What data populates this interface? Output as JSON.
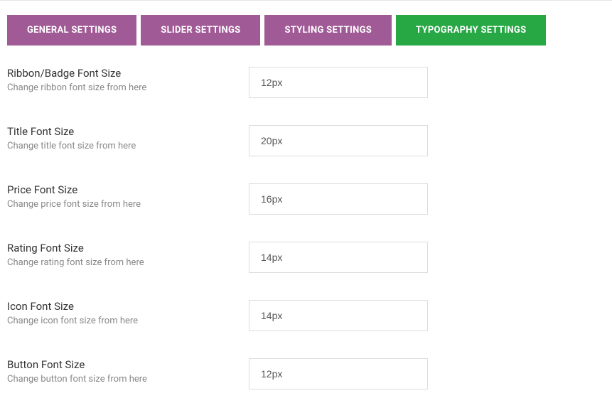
{
  "tabs": [
    {
      "label": "GENERAL SETTINGS",
      "active": false
    },
    {
      "label": "SLIDER SETTINGS",
      "active": false
    },
    {
      "label": "STYLING SETTINGS",
      "active": false
    },
    {
      "label": "TYPOGRAPHY SETTINGS",
      "active": true
    }
  ],
  "fields": {
    "ribbon": {
      "label": "Ribbon/Badge Font Size",
      "desc": "Change ribbon font size from here",
      "value": "12px"
    },
    "title": {
      "label": "Title Font Size",
      "desc": "Change title font size from here",
      "value": "20px"
    },
    "price": {
      "label": "Price Font Size",
      "desc": "Change price font size from here",
      "value": "16px"
    },
    "rating": {
      "label": "Rating Font Size",
      "desc": "Change rating font size from here",
      "value": "14px"
    },
    "icon": {
      "label": "Icon Font Size",
      "desc": "Change icon font size from here",
      "value": "14px"
    },
    "button": {
      "label": "Button Font Size",
      "desc": "Change button font size from here",
      "value": "12px"
    }
  }
}
